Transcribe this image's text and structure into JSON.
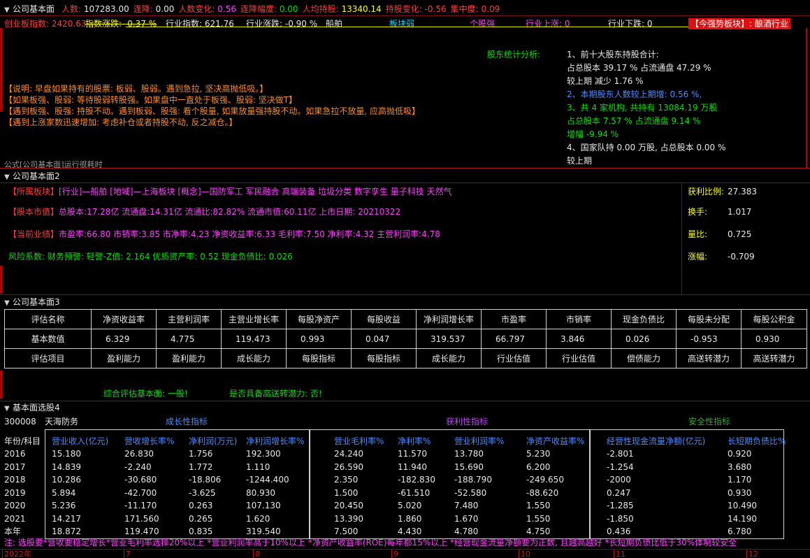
{
  "panel1": {
    "title": "公司基本面",
    "stats": [
      {
        "label": "人数:",
        "value": "107283.00",
        "cls": "w"
      },
      {
        "label": "连降:",
        "value": "0.00",
        "cls": "w"
      },
      {
        "label": "人数变化:",
        "value": "0.56",
        "cls": "m"
      },
      {
        "label": "连降幅度:",
        "value": "0.00",
        "cls": "g"
      },
      {
        "label": "人均持股:",
        "value": "13340.14",
        "cls": "y"
      },
      {
        "label": "持股变化:",
        "value": "-0.56",
        "cls": "r"
      },
      {
        "label": "集中度:",
        "value": "0.09",
        "cls": "r"
      }
    ],
    "sector": {
      "index_label": "创业板指数:",
      "index_value": "2420.63",
      "change_label": "指数涨跌:",
      "change_value": "-0.37 %",
      "ind_index": "行业指数: 621.76",
      "ind_change": "行业涨跌: -0.90 %",
      "ind_name": "船舶",
      "board_status": "板块弱",
      "buy_sell": "个股强",
      "ind_up": "行业上涨: 0",
      "ind_down": "行业下跌: 0",
      "strong": "【今强势板块】: 酿酒行业"
    },
    "notes": [
      "【说明: 早盘如果持有的股票: 板弱、股弱。遇到急拉, 坚决高抛低吸。】",
      "【如果板强、股弱: 等待股弱转股强。如果盘中一直处于板强、股弱: 坚决做T】",
      "【遇到板强、股强: 持股不动。遇到板弱、股强: 看个股量, 如果放量强持股不动。如果急拉不放量, 应高抛低吸】",
      "【遇到上涨家数迅速增加: 考虑补仓或者持股不动, 反之减仓。】"
    ],
    "holder_heading": "股东统计分析:",
    "holder_lines": [
      {
        "text": "1、前十大股东持股合计:",
        "cls": "w"
      },
      {
        "text": "占总股本 39.17 %   占流通盘 47.29 %",
        "cls": "w"
      },
      {
        "text": "较上期 减少 1.76 %",
        "cls": "w"
      },
      {
        "text": "2、本期股东人数较上期增:  0.56 %,",
        "cls": "b"
      },
      {
        "text": "3、共 4 家机构, 共持有 13084.19 万股",
        "cls": "g"
      },
      {
        "text": "占总股本 7.57 %   占流通盘 9.14 %",
        "cls": "g"
      },
      {
        "text": "增幅 -9.94 %",
        "cls": "g"
      },
      {
        "text": "4、国家队持 0.00 万股, 占总股本 0.00 %",
        "cls": "w"
      },
      {
        "text": "较上期",
        "cls": "w"
      }
    ],
    "footer": "公式[公司基本面]运行很耗时"
  },
  "panel2": {
    "title": "公司基本面2",
    "lines": [
      {
        "head": "【所属板块】",
        "body": "[行业]—船舶 [地域]—上海板块 [概念]—国防军工 军民融合 高端装备 垃圾分类 数字孪生 量子科技 天然气"
      },
      {
        "head": "【股本市值】",
        "body": "总股本:17.28亿 流通盘:14.31亿 流通比:82.82% 流通市值:60.11亿 上市日期: 20210322"
      },
      {
        "head": "【当前业绩】",
        "body": "市盈率:66.80 市销率:3.85 市净率:4.23 净资收益率:6.33 毛利率:7.50 净利率:4.32 主营利润率:4.78"
      }
    ],
    "risk": "风险系数: 财务预警: 轻警-Z值: 2.164 优质资产率: 0.52 现金负债比: 0.026",
    "right": [
      {
        "label": "获利比例:",
        "value": "27.383"
      },
      {
        "label": "换手:",
        "value": "1.017"
      },
      {
        "label": "量比:",
        "value": "0.725"
      },
      {
        "label": "涨幅:",
        "value": "-0.709"
      }
    ]
  },
  "panel3": {
    "title": "公司基本面3",
    "headers": [
      "评估名称",
      "净资收益率",
      "主营利润率",
      "主营业增长率",
      "每股净资产",
      "每股收益",
      "净利润增长率",
      "市盈率",
      "市销率",
      "现金负债比",
      "每股未分配",
      "每股公积金"
    ],
    "values": [
      "基本数值",
      "6.329",
      "4.775",
      "119.473",
      "0.993",
      "0.047",
      "319.537",
      "66.797",
      "3.846",
      "0.026",
      "-0.953",
      "0.930"
    ],
    "items": [
      "评估项目",
      "盈利能力",
      "盈利能力",
      "成长能力",
      "每股指标",
      "每股指标",
      "成长能力",
      "行业估值",
      "行业估值",
      "偿债能力",
      "高送转潜力",
      "高送转潜力"
    ],
    "verdict1": "综合评估基本面: 一般!",
    "verdict2": "是否具备高送转潜力: 否!"
  },
  "panel4": {
    "title": "基本面选股4",
    "code": "300008",
    "name": "天海防务",
    "group_growth": "成长性指标",
    "group_profit": "获利性指标",
    "group_safety": "安全性指标",
    "columns": [
      "年份/科目",
      "营业收入(亿元)",
      "营收增长率%",
      "净利润(万元)",
      "净利润增长率%",
      "营业毛利率%",
      "净利率%",
      "营业利润率%",
      "净资产收益率%",
      "经营性现金流量净额(亿元)",
      "长短期负债比%"
    ],
    "rows": [
      [
        "2016",
        "15.180",
        "26.830",
        "1.756",
        "192.300",
        "24.240",
        "11.570",
        "13.780",
        "5.230",
        "-2.801",
        "0.920"
      ],
      [
        "2017",
        "14.839",
        "-2.240",
        "1.772",
        "1.110",
        "26.590",
        "11.940",
        "15.690",
        "6.200",
        "-1.254",
        "3.680"
      ],
      [
        "2018",
        "10.286",
        "-30.680",
        "-18.806",
        "-1244.400",
        "2.350",
        "-182.830",
        "-188.790",
        "-249.650",
        "-2000",
        "1.170"
      ],
      [
        "2019",
        "5.894",
        "-42.700",
        "-3.625",
        "80.930",
        "1.500",
        "-61.510",
        "-52.580",
        "-88.620",
        "0.247",
        "0.930"
      ],
      [
        "2020",
        "5.236",
        "-11.170",
        "0.263",
        "107.130",
        "20.450",
        "5.020",
        "7.480",
        "1.550",
        "-1.285",
        "10.490"
      ],
      [
        "2021",
        "14.217",
        "171.560",
        "0.265",
        "1.620",
        "13.390",
        "1.860",
        "1.670",
        "1.550",
        "-1.850",
        "14.190"
      ],
      [
        "本年",
        "18.872",
        "119.470",
        "0.835",
        "319.540",
        "7.500",
        "4.430",
        "4.780",
        "4.750",
        "0.436",
        "6.780"
      ]
    ],
    "note": "注: 选股要*营收要稳定增长*营业毛利率选择20%以上 *营业利润率高于10%以上 *净资产收益率(ROE)每年都15%以上 *经营现金流量净额要为正数, 且越高越好 *长短期负债比低于30%体制较安全"
  },
  "ruler": {
    "labels": [
      "2022年",
      "7",
      "8",
      "9",
      "10",
      "11",
      "12"
    ]
  }
}
